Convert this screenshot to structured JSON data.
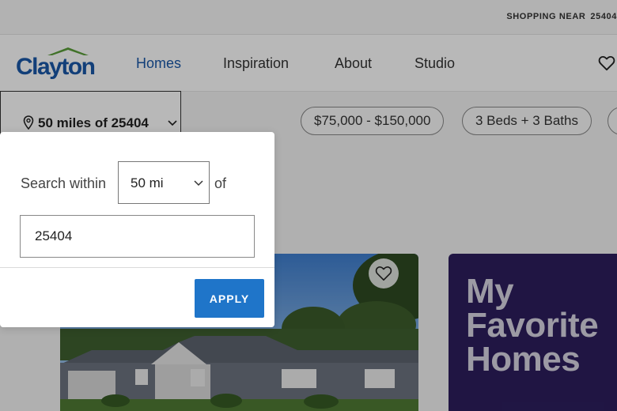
{
  "topbar": {
    "shopping_label": "SHOPPING NEAR",
    "zip": "25404"
  },
  "brand": {
    "name": "Clayton",
    "color": "#1a58a8",
    "roof_color": "#5a9e3a"
  },
  "nav": {
    "items": [
      {
        "label": "Homes",
        "active": true
      },
      {
        "label": "Inspiration",
        "active": false
      },
      {
        "label": "About",
        "active": false
      },
      {
        "label": "Studio",
        "active": false
      }
    ],
    "favorites_icon": "heart-icon"
  },
  "filters": {
    "location_label": "50 miles of 25404",
    "location_icon": "map-pin-icon",
    "price_pill": "$75,000 - $150,000",
    "beds_baths_pill": "3 Beds + 3 Baths"
  },
  "location_popover": {
    "search_within_label": "Search within",
    "radius_value": "50 mi",
    "of_label": "of",
    "zip_value": "25404",
    "apply_label": "APPLY",
    "apply_color": "#1f75c9"
  },
  "cards": {
    "favorite_icon": "heart-icon",
    "promo_lines": [
      "My",
      "Favorite",
      "Homes"
    ],
    "promo_bg": "#2d1e5e"
  }
}
